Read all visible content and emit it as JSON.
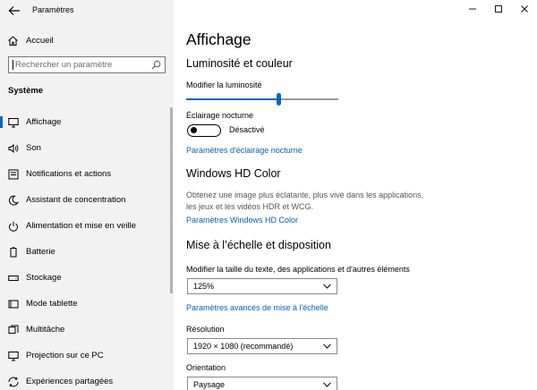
{
  "window": {
    "title": "Paramètres",
    "controls": [
      "minimize-icon",
      "maximize-icon",
      "close-icon"
    ]
  },
  "sidebar": {
    "home_label": "Accueil",
    "search_placeholder": "Rechercher un paramètre",
    "section_title": "Système",
    "items": [
      {
        "label": "Affichage",
        "icon": "display-icon",
        "selected": true
      },
      {
        "label": "Son",
        "icon": "speaker-icon",
        "selected": false
      },
      {
        "label": "Notifications et actions",
        "icon": "notifications-icon",
        "selected": false
      },
      {
        "label": "Assistant de concentration",
        "icon": "moon-icon",
        "selected": false
      },
      {
        "label": "Alimentation et mise en veille",
        "icon": "power-icon",
        "selected": false
      },
      {
        "label": "Batterie",
        "icon": "battery-icon",
        "selected": false
      },
      {
        "label": "Stockage",
        "icon": "storage-icon",
        "selected": false
      },
      {
        "label": "Mode tablette",
        "icon": "tablet-icon",
        "selected": false
      },
      {
        "label": "Multitâche",
        "icon": "multitask-icon",
        "selected": false
      },
      {
        "label": "Projection sur ce PC",
        "icon": "projection-icon",
        "selected": false
      },
      {
        "label": "Expériences partagées",
        "icon": "shared-experiences-icon",
        "selected": false
      }
    ]
  },
  "main": {
    "title": "Affichage",
    "brightness": {
      "heading": "Luminosité et couleur",
      "slider_label": "Modifier la luminosité",
      "slider_value": 0.61
    },
    "night_light": {
      "label": "Éclairage nocturne",
      "state": "Désactivé",
      "is_on": false,
      "settings_link": "Paramètres d'éclairage nocturne"
    },
    "hd_color": {
      "heading": "Windows HD Color",
      "description": "Obtenez une image plus éclatante, plus vive dans les applications, les jeux et les vidéos HDR et WCG.",
      "settings_link": "Paramètres Windows HD Color"
    },
    "scale_layout": {
      "heading": "Mise à l’échelle et disposition",
      "scale_label": "Modifier la taille du texte, des applications et d'autres éléments",
      "scale_value": "125%",
      "advanced_link": "Paramètres avancés de mise à l'échelle",
      "resolution_label": "Résolution",
      "resolution_value": "1920 × 1080 (recommandé)",
      "orientation_label": "Orientation",
      "orientation_value": "Paysage"
    }
  },
  "colors": {
    "accent": "#0067c0",
    "link": "#0063b1",
    "sidebar_bg": "#f2f2f2"
  }
}
